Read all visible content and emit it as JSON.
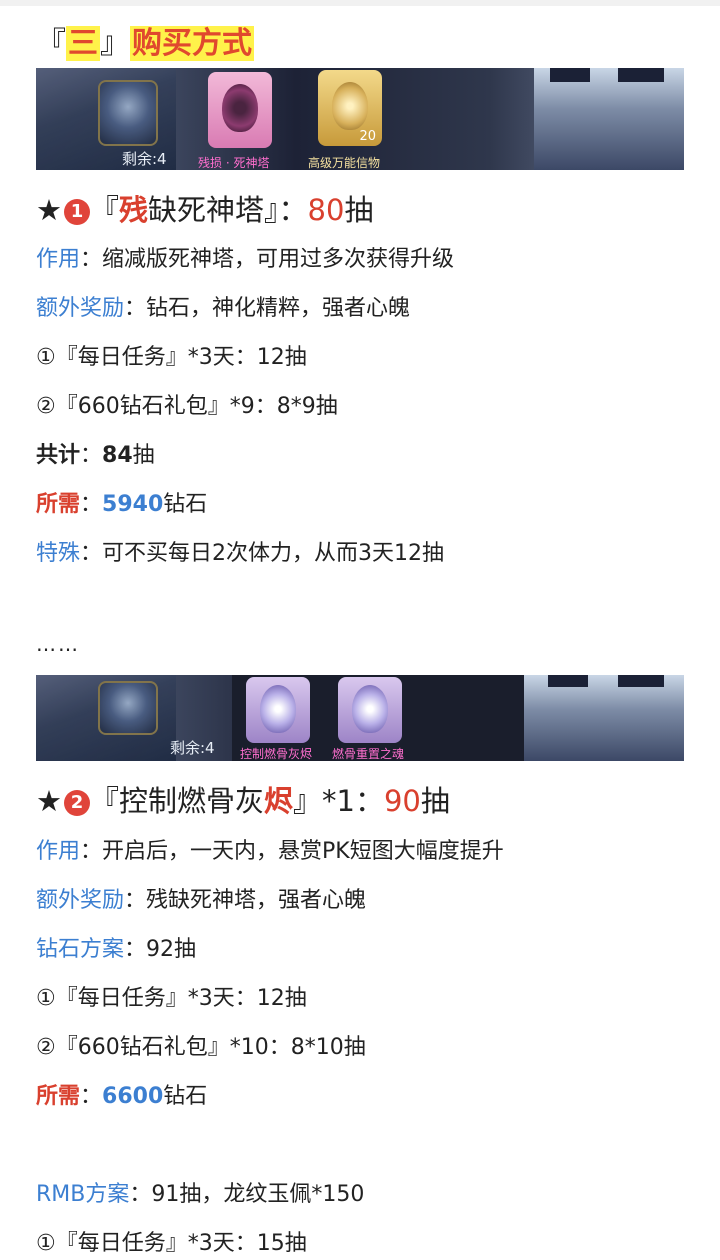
{
  "section": {
    "bracket_open": "『",
    "number": "三",
    "bracket_close": "』",
    "title": "购买方式"
  },
  "banner1": {
    "remain": "剩余:4",
    "items": [
      {
        "label": "残损 · 死神塔",
        "count": ""
      },
      {
        "label": "高级万能信物",
        "count": "20"
      }
    ]
  },
  "item1": {
    "star": "★",
    "index": "1",
    "name_open": "『",
    "name_red": "残",
    "name_rest": "缺死神塔』：",
    "pulls_num": "80",
    "pulls_unit": "抽",
    "effect_label": "作用",
    "effect_text": "：缩减版死神塔，可用过多次获得升级",
    "bonus_label": "额外奖励",
    "bonus_text": "：钻石，神化精粹，强者心魄",
    "line1": "①『每日任务』*3天：12抽",
    "line2": "②『660钻石礼包』*9：8*9抽",
    "total_label": "共计",
    "total_sep": "：",
    "total_num": "84",
    "total_unit": "抽",
    "need_label": "所需",
    "need_sep": "：",
    "need_num": "5940",
    "need_unit": "钻石",
    "special_label": "特殊",
    "special_text": "：可不买每日2次体力，从而3天12抽"
  },
  "ellipsis": "……",
  "banner2": {
    "remain": "剩余:4",
    "items": [
      {
        "label": "控制燃骨灰烬"
      },
      {
        "label": "燃骨重置之魂"
      }
    ]
  },
  "item2": {
    "star": "★",
    "index": "2",
    "name_open": "『控制燃骨灰",
    "name_red": "烬",
    "name_rest": "』*1：",
    "pulls_num": "90",
    "pulls_unit": "抽",
    "effect_label": "作用",
    "effect_text": "：开启后，一天内，悬赏PK短图大幅度提升",
    "bonus_label": "额外奖励",
    "bonus_text": "：残缺死神塔，强者心魄",
    "diamond_label": "钻石方案",
    "diamond_text": "：92抽",
    "line1": "①『每日任务』*3天：12抽",
    "line2": "②『660钻石礼包』*10：8*10抽",
    "need_label": "所需",
    "need_sep": "：",
    "need_num": "6600",
    "need_unit": "钻石",
    "rmb_label": "RMB方案",
    "rmb_text": "：91抽，龙纹玉佩*150",
    "rmb_line1": "①『每日任务』*3天：15抽"
  }
}
